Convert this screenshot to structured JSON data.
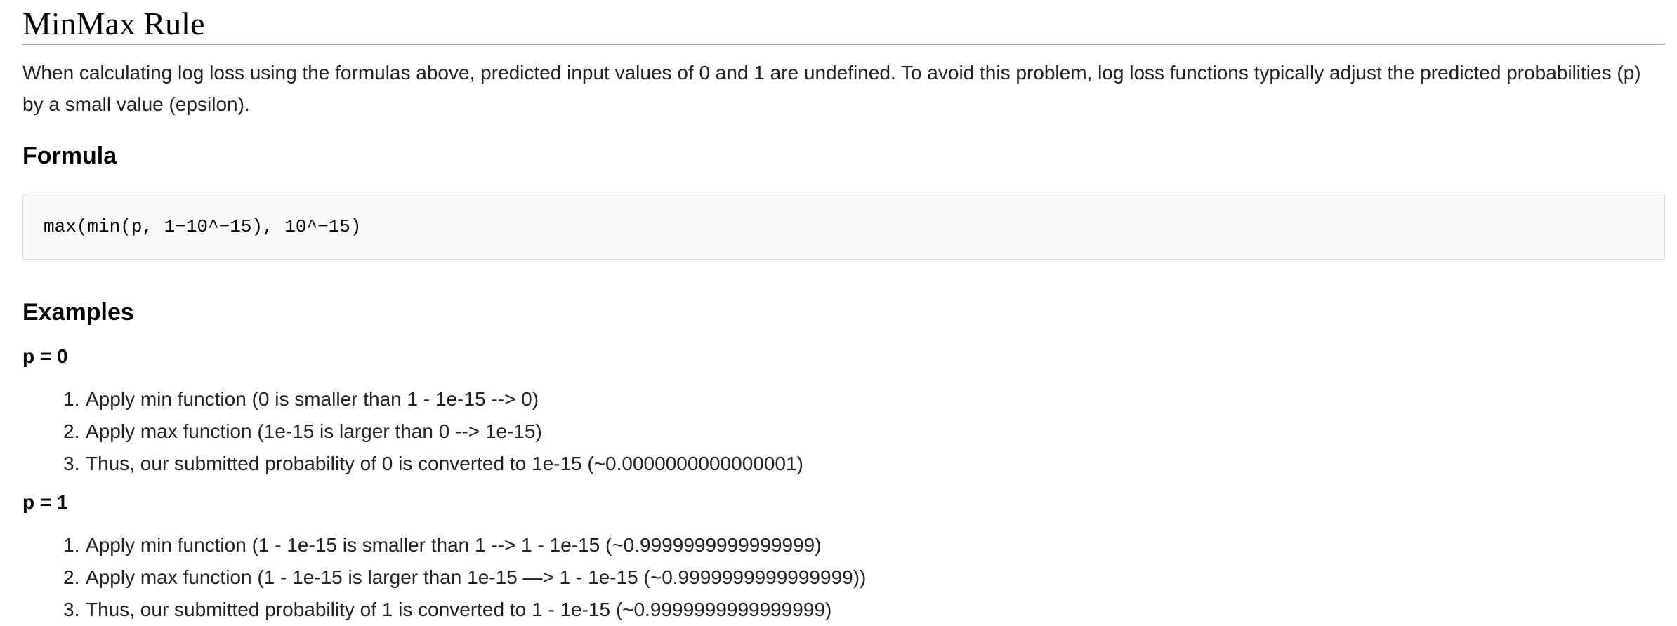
{
  "page": {
    "title": "MinMax Rule",
    "intro": "When calculating log loss using the formulas above, predicted input values of 0 and 1 are undefined. To avoid this problem, log loss functions typically adjust the predicted probabilities (p) by a small value (epsilon)."
  },
  "formula": {
    "heading": "Formula",
    "code": "max(min(p, 1−10^−15), 10^−15)"
  },
  "examples": {
    "heading": "Examples",
    "cases": [
      {
        "label": "p = 0",
        "steps": [
          {
            "num": "1.",
            "text": "Apply min function (0 is smaller than 1 - 1e-15 --> 0)"
          },
          {
            "num": "2.",
            "text": "Apply max function (1e-15 is larger than 0 --> 1e-15)"
          },
          {
            "num": "3.",
            "text": "Thus, our submitted probability of 0 is converted to 1e-15 (~0.0000000000000001)"
          }
        ]
      },
      {
        "label": "p = 1",
        "steps": [
          {
            "num": "1.",
            "text": "Apply min function (1 - 1e-15 is smaller than 1 --> 1 - 1e-15 (~0.9999999999999999)"
          },
          {
            "num": "2.",
            "text": "Apply max function (1 - 1e-15 is larger than 1e-15 —> 1 - 1e-15 (~0.9999999999999999))"
          },
          {
            "num": "3.",
            "text": "Thus, our submitted probability of 1 is converted to 1 - 1e-15 (~0.9999999999999999)"
          }
        ]
      }
    ]
  }
}
